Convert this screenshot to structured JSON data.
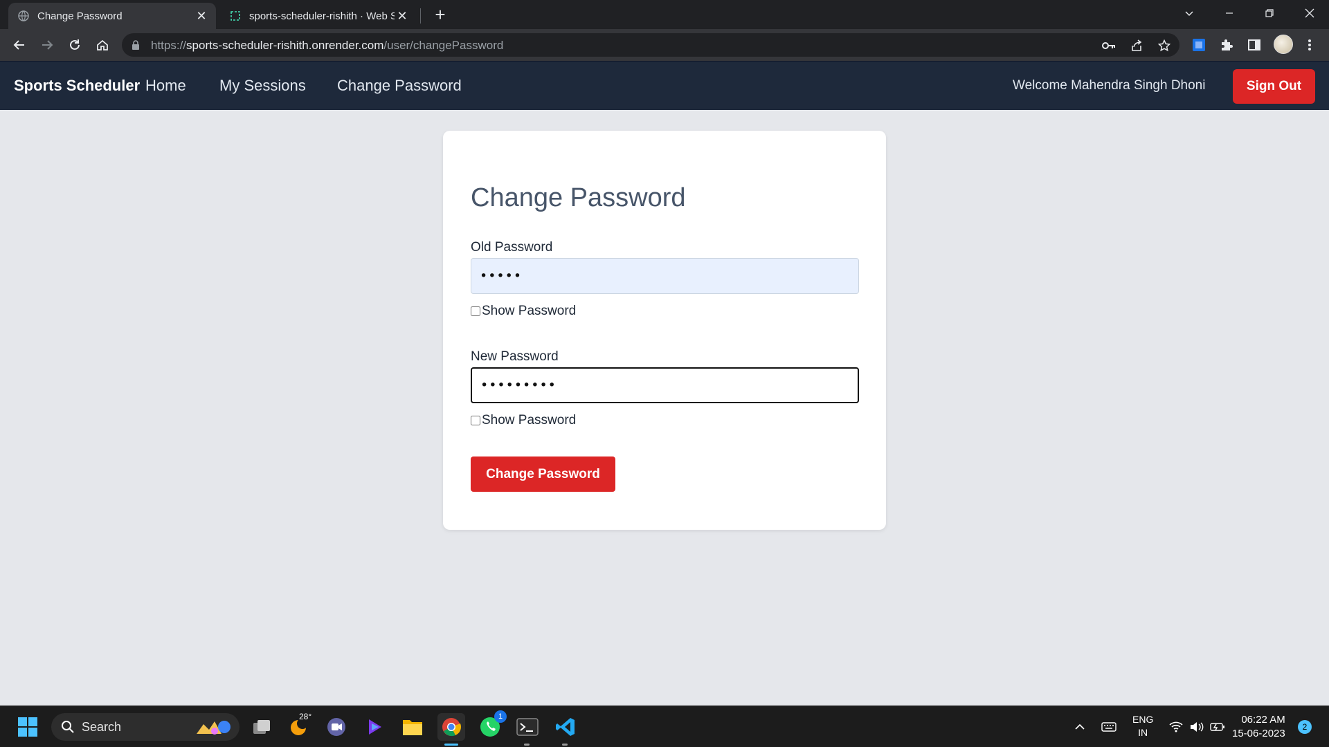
{
  "browser": {
    "tabs": [
      {
        "title": "Change Password",
        "active": true
      },
      {
        "title": "sports-scheduler-rishith · Web Se",
        "active": false
      }
    ],
    "url": {
      "scheme": "https://",
      "host": "sports-scheduler-rishith.onrender.com",
      "path": "/user/changePassword"
    }
  },
  "navbar": {
    "brand": "Sports Scheduler",
    "links": [
      "Home",
      "My Sessions",
      "Change Password"
    ],
    "welcome": "Welcome Mahendra Singh Dhoni",
    "signout_label": "Sign Out"
  },
  "form": {
    "title": "Change Password",
    "old_password": {
      "label": "Old Password",
      "masked_value": "•••••"
    },
    "new_password": {
      "label": "New Password",
      "masked_value": "•••••••••"
    },
    "show_password_label": "Show Password",
    "submit_label": "Change Password"
  },
  "taskbar": {
    "search_label": "Search",
    "weather_temp": "28°",
    "whatsapp_badge": "1",
    "language": "ENG",
    "region": "IN",
    "time": "06:22 AM",
    "date": "15-06-2023",
    "notification_count": "2"
  },
  "colors": {
    "navbar_bg": "#1e293b",
    "accent_red": "#dc2626",
    "page_bg": "#e5e7eb"
  }
}
